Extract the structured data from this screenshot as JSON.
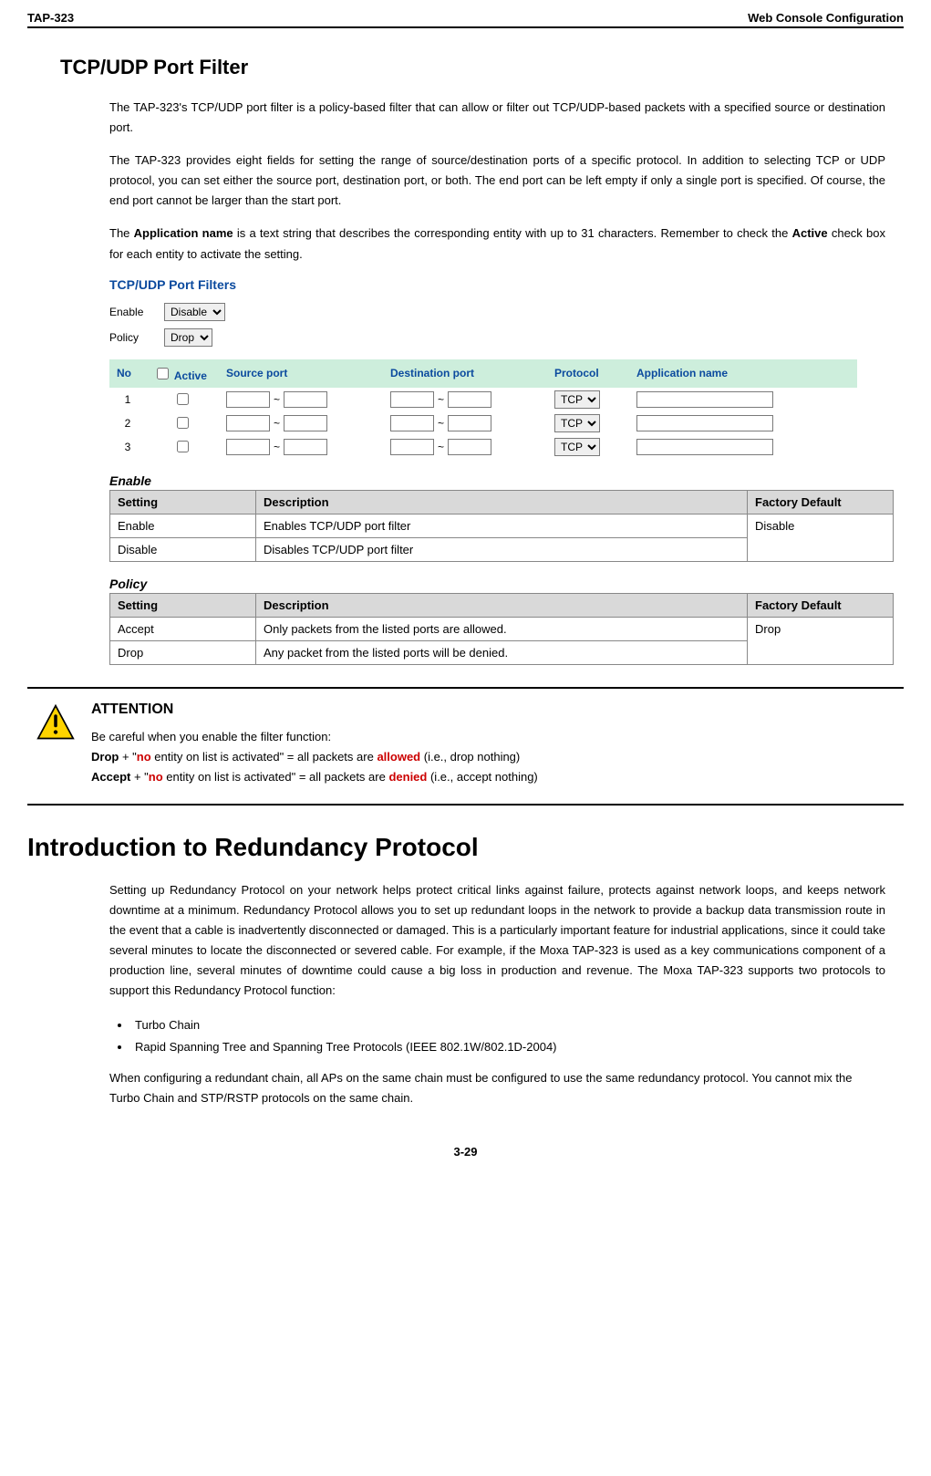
{
  "hdr": {
    "left": "TAP-323",
    "right": "Web Console Configuration"
  },
  "h2": "TCP/UDP Port Filter",
  "p1": "The TAP-323's TCP/UDP port filter is a policy-based filter that can allow or filter out TCP/UDP-based packets with a specified source or destination port.",
  "p2": "The TAP-323 provides eight fields for setting the range of source/destination ports of a specific protocol. In addition to selecting TCP or UDP protocol, you can set either the source port, destination port, or both. The end port can be left empty if only a single port is specified. Of course, the end port cannot be larger than the start port.",
  "p3a": "The ",
  "p3b": "Application name",
  "p3c": " is a text string that describes the corresponding entity with up to 31 characters. Remember to check the ",
  "p3d": "Active",
  "p3e": " check box for each entity to activate the setting.",
  "cfg": {
    "title": "TCP/UDP Port Filters",
    "enable_lbl": "Enable",
    "policy_lbl": "Policy",
    "enable_val": "Disable",
    "policy_val": "Drop",
    "cols": {
      "no": "No",
      "active": "Active",
      "src": "Source port",
      "dst": "Destination port",
      "proto": "Protocol",
      "app": "Application name"
    },
    "rows": [
      {
        "no": "1",
        "proto": "TCP"
      },
      {
        "no": "2",
        "proto": "TCP"
      },
      {
        "no": "3",
        "proto": "TCP"
      }
    ]
  },
  "enable_hdr": "Enable",
  "enable_tbl": {
    "h1": "Setting",
    "h2": "Description",
    "h3": "Factory Default",
    "r1c1": "Enable",
    "r1c2": "Enables TCP/UDP port filter",
    "r1c3": "Disable",
    "r2c1": "Disable",
    "r2c2": "Disables TCP/UDP port filter"
  },
  "policy_hdr": "Policy",
  "policy_tbl": {
    "h1": "Setting",
    "h2": "Description",
    "h3": "Factory Default",
    "r1c1": "Accept",
    "r1c2": "Only packets from the listed ports are allowed.",
    "r1c3": "Drop",
    "r2c1": "Drop",
    "r2c2": "Any packet from the listed ports will be denied."
  },
  "attn": {
    "title": "ATTENTION",
    "intro": "Be careful when you enable the filter function:",
    "l1a": "Drop",
    "l1b": " + \"",
    "l1c": "no",
    "l1d": " entity on list is activated\" = all packets are ",
    "l1e": "allowed",
    "l1f": " (i.e., drop nothing)",
    "l2a": "Accept",
    "l2b": " + \"",
    "l2c": "no",
    "l2d": " entity on list is activated\" = all packets are ",
    "l2e": "denied",
    "l2f": " (i.e., accept nothing)"
  },
  "h1": "Introduction to Redundancy Protocol",
  "redp": "Setting up Redundancy Protocol on your network helps protect critical links against failure, protects against network loops, and keeps network downtime at a minimum. Redundancy Protocol allows you to set up redundant loops in the network to provide a backup data transmission route in the event that a cable is inadvertently disconnected or damaged. This is a particularly important feature for industrial applications, since it could take several minutes to locate the disconnected or severed cable. For example, if the Moxa TAP-323 is used as a key communications component of a production line, several minutes of downtime could cause a big loss in production and revenue. The Moxa TAP-323 supports two protocols to support this Redundancy Protocol function:",
  "bul": {
    "b1": "Turbo Chain",
    "b2": "Rapid Spanning Tree and Spanning Tree Protocols (IEEE 802.1W/802.1D-2004)"
  },
  "after": "When configuring a redundant chain, all APs on the same chain must be configured to use the same redundancy protocol. You cannot mix the Turbo Chain and STP/RSTP protocols on the same chain.",
  "pagenum": "3-29"
}
